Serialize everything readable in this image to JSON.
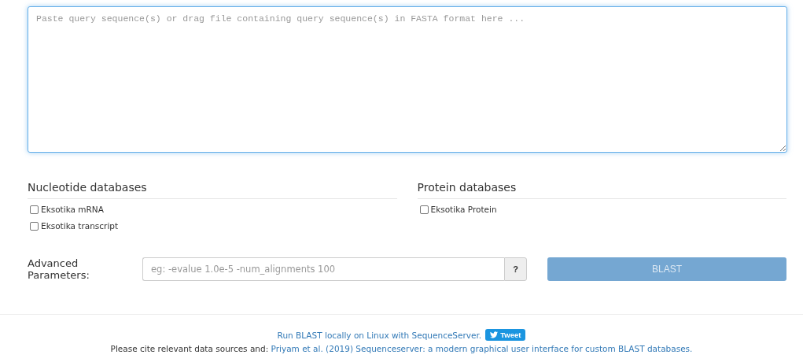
{
  "query": {
    "placeholder": "Paste query sequence(s) or drag file containing query sequence(s) in FASTA format here ..."
  },
  "databases": [
    {
      "title": "Nucleotide databases",
      "items": [
        {
          "label": "Eksotika mRNA",
          "checked": false
        },
        {
          "label": "Eksotika transcript",
          "checked": false
        }
      ]
    },
    {
      "title": "Protein databases",
      "items": [
        {
          "label": "Eksotika Protein",
          "checked": false
        }
      ]
    }
  ],
  "advanced": {
    "label": "Advanced Parameters:",
    "placeholder": "eg: -evalue 1.0e-5 -num_alignments 100",
    "help": "?"
  },
  "submit": {
    "label": "BLAST",
    "disabled": true
  },
  "footer": {
    "link": "Run BLAST locally on Linux with SequenceServer.",
    "tweet": "Tweet",
    "cite_text": "Please cite relevant data sources and: ",
    "cite_link": "Priyam et al. (2019) Sequenceserver: a modern graphical user interface for custom BLAST databases."
  }
}
